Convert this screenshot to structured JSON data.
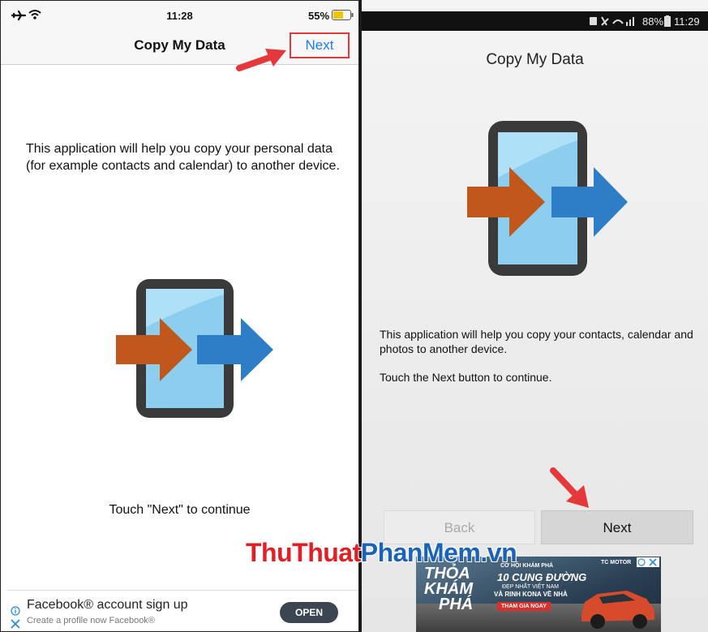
{
  "ios": {
    "status": {
      "time": "11:28",
      "battery": "55%"
    },
    "nav": {
      "title": "Copy My Data",
      "next_label": "Next"
    },
    "body_text": "This application will help you copy your personal data (for example contacts and calendar) to another device.",
    "touch_text": "Touch \"Next\" to continue",
    "ad": {
      "title": "Facebook® account sign up",
      "subtitle": "Create a profile now Facebook®",
      "button_label": "OPEN"
    }
  },
  "android": {
    "status": {
      "signal_text": "88%",
      "time": "11:29"
    },
    "title": "Copy My Data",
    "body_text": "This application will help you copy your contacts, calendar and photos to another device.",
    "touch_text": "Touch the Next button to continue.",
    "back_label": "Back",
    "next_label": "Next",
    "ad": {
      "line1": "THỎA",
      "line2": "KHÁM",
      "line3": "PHÁ",
      "headline_small": "CƠ HỘI KHÁM PHÁ",
      "headline": "10 CUNG ĐƯỜNG",
      "sub1": "ĐẸP NHẤT VIỆT NAM",
      "sub2": "VÀ RINH KONA VỀ NHÀ",
      "cta": "THAM GIA NGAY",
      "brand": "TC MOTOR"
    }
  },
  "watermark": {
    "part1": "ThuThuat",
    "part2": "PhanMem",
    "part3": ".vn"
  },
  "colors": {
    "ios_blue": "#1e7cf2",
    "highlight_red": "#e5383a",
    "arrow_orange": "#c0581b",
    "arrow_blue": "#2d7ec6"
  }
}
